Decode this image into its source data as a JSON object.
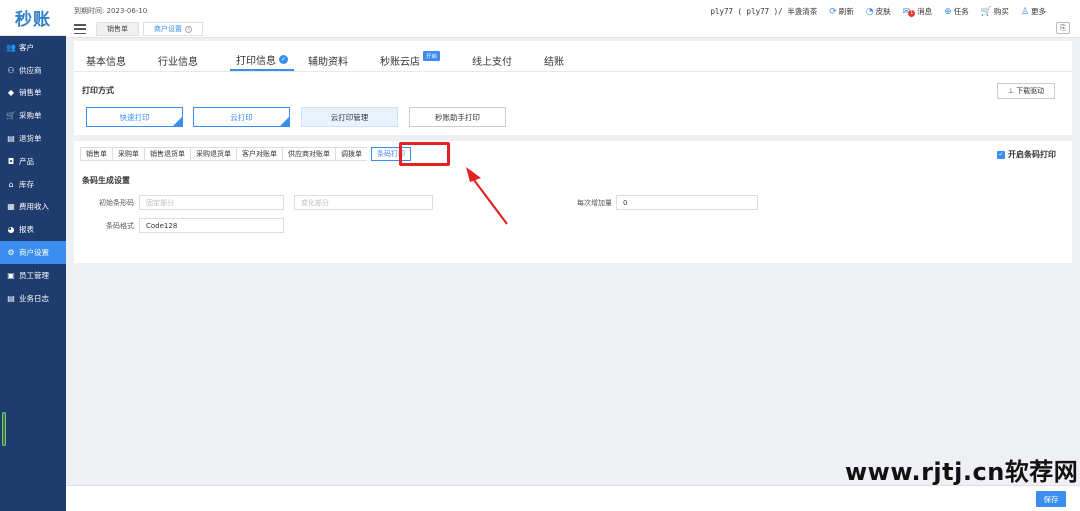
{
  "app": {
    "logo": "秒账"
  },
  "sidebar": {
    "items": [
      {
        "label": "客户",
        "icon": "👥"
      },
      {
        "label": "供应商",
        "icon": "⚇"
      },
      {
        "label": "销售单",
        "icon": "◆"
      },
      {
        "label": "采购单",
        "icon": "🛒"
      },
      {
        "label": "退货单",
        "icon": "▤"
      },
      {
        "label": "产品",
        "icon": "◘"
      },
      {
        "label": "库存",
        "icon": "⌂"
      },
      {
        "label": "费用收入",
        "icon": "▦"
      },
      {
        "label": "报表",
        "icon": "◕"
      },
      {
        "label": "商户设置",
        "icon": "⚙"
      },
      {
        "label": "员工管理",
        "icon": "▣"
      },
      {
        "label": "业务日志",
        "icon": "▤"
      }
    ],
    "active_index": 9
  },
  "topbar": {
    "expire": "到期时间: 2023-06-10",
    "tabs": [
      {
        "label": "销售单"
      },
      {
        "label": "商户设置"
      }
    ],
    "account": "ply77 ( ply77 )/ 半盏清茶",
    "actions": [
      {
        "label": "刷新",
        "icon": "⟳"
      },
      {
        "label": "皮肤",
        "icon": "◔"
      },
      {
        "label": "消息",
        "icon": "✉"
      },
      {
        "label": "任务",
        "icon": "⊕"
      },
      {
        "label": "购买",
        "icon": "🛒"
      },
      {
        "label": "更多",
        "icon": "♙"
      }
    ],
    "message_badge": "1"
  },
  "settings_tabs": [
    {
      "label": "基本信息"
    },
    {
      "label": "行业信息"
    },
    {
      "label": "打印信息"
    },
    {
      "label": "辅助资料"
    },
    {
      "label": "秒账云店",
      "tag": "开启"
    },
    {
      "label": "线上支付"
    },
    {
      "label": "结账"
    }
  ],
  "print": {
    "section_title": "打印方式",
    "download_label": "⊥ 下载驱动",
    "buttons": [
      {
        "label": "快速打印"
      },
      {
        "label": "云打印"
      },
      {
        "label": "云打印管理"
      },
      {
        "label": "秒账助手打印"
      }
    ]
  },
  "subtabs": [
    "销售单",
    "采购单",
    "销售退货单",
    "采购退货单",
    "客户对账单",
    "供应商对账单",
    "调拨单",
    "条码打印"
  ],
  "barcode": {
    "enable_label": "开启条码打印",
    "enabled": true,
    "section_title": "条码生成设置",
    "initial_label": "初始条形码",
    "fixed_placeholder": "固定部分",
    "variable_placeholder": "变化部分",
    "increment_label": "每次增加量",
    "increment_value": "0",
    "format_label": "条码格式",
    "format_value": "Code128"
  },
  "footer": {
    "save_label": "保存"
  },
  "watermark": "www.rjtj.cn软荐网"
}
